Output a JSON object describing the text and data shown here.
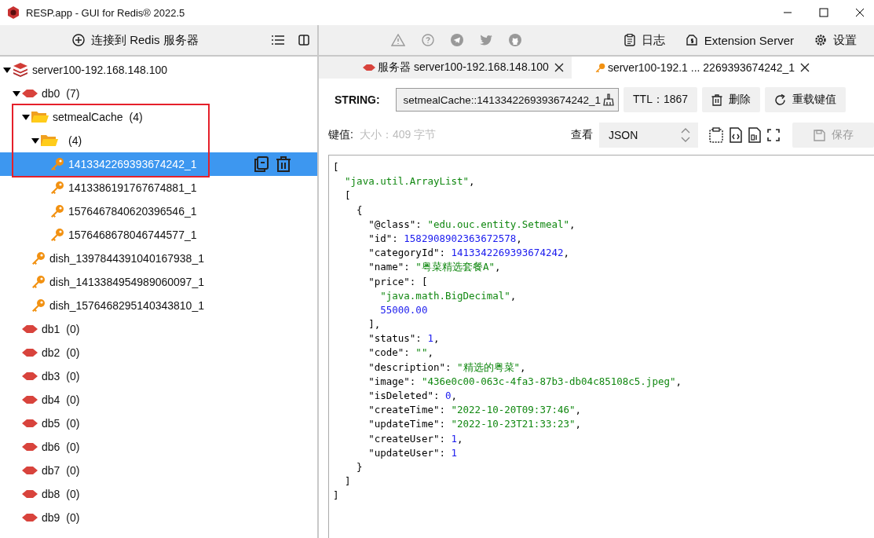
{
  "window": {
    "title": "RESP.app - GUI for Redis® 2022.5"
  },
  "sidebar": {
    "connect_button": "连接到 Redis 服务器",
    "tree": [
      {
        "kind": "server",
        "label": "server100-192.168.148.100",
        "expanded": true,
        "selected": false,
        "children": [
          {
            "kind": "db",
            "label": "db0",
            "count": "(7)",
            "expanded": true,
            "selected": false,
            "children": [
              {
                "kind": "folder",
                "label": "setmealCache",
                "count": "(4)",
                "expanded": true,
                "selected": false,
                "children": [
                  {
                    "kind": "folder",
                    "count": "(4)",
                    "expanded": true,
                    "selected": false,
                    "children": [
                      {
                        "kind": "key",
                        "label": "1413342269393674242_1",
                        "selected": true
                      },
                      {
                        "kind": "key",
                        "label": "1413386191767674881_1",
                        "selected": false
                      },
                      {
                        "kind": "key",
                        "label": "1576467840620396546_1",
                        "selected": false
                      },
                      {
                        "kind": "key",
                        "label": "1576468678046744577_1",
                        "selected": false
                      }
                    ]
                  }
                ]
              },
              {
                "kind": "key",
                "label": "dish_1397844391040167938_1",
                "selected": false
              },
              {
                "kind": "key",
                "label": "dish_1413384954989060097_1",
                "selected": false
              },
              {
                "kind": "key",
                "label": "dish_1576468295140343810_1",
                "selected": false
              }
            ]
          },
          {
            "kind": "db",
            "label": "db1",
            "count": "(0)",
            "selected": false
          },
          {
            "kind": "db",
            "label": "db2",
            "count": "(0)",
            "selected": false
          },
          {
            "kind": "db",
            "label": "db3",
            "count": "(0)",
            "selected": false
          },
          {
            "kind": "db",
            "label": "db4",
            "count": "(0)",
            "selected": false
          },
          {
            "kind": "db",
            "label": "db5",
            "count": "(0)",
            "selected": false
          },
          {
            "kind": "db",
            "label": "db6",
            "count": "(0)",
            "selected": false
          },
          {
            "kind": "db",
            "label": "db7",
            "count": "(0)",
            "selected": false
          },
          {
            "kind": "db",
            "label": "db8",
            "count": "(0)",
            "selected": false
          },
          {
            "kind": "db",
            "label": "db9",
            "count": "(0)",
            "selected": false
          }
        ]
      }
    ]
  },
  "toolbar": {
    "log_button": "日志",
    "extension_button": "Extension Server",
    "settings_button": "设置"
  },
  "tabs": [
    {
      "kind": "server",
      "label": "服务器 server100-192.168.148.100",
      "selected": false
    },
    {
      "kind": "key",
      "label": "server100-192.1 ... 2269393674242_1",
      "selected": true
    }
  ],
  "key_panel": {
    "type_label": "STRING:",
    "key_name": "setmealCache::1413342269393674242_1",
    "ttl": "TTL：1867",
    "delete_button": "删除",
    "reload_button": "重载键值",
    "value_label": "键值:",
    "size": "大小：409 字节",
    "view_label": "查看",
    "view_format": "JSON",
    "save_button": {
      "label": "保存",
      "disabled": true
    }
  },
  "editor": {
    "lines": [
      [
        {
          "kind": "plain",
          "text": "["
        }
      ],
      [
        {
          "kind": "string",
          "text": "  \"java.util.ArrayList\""
        },
        {
          "kind": "plain",
          "text": ","
        }
      ],
      [
        {
          "kind": "plain",
          "text": "  ["
        }
      ],
      [
        {
          "kind": "plain",
          "text": "    {"
        }
      ],
      [
        {
          "kind": "plain",
          "text": "      \"@class\": "
        },
        {
          "kind": "string",
          "text": "\"edu.ouc.entity.Setmeal\""
        },
        {
          "kind": "plain",
          "text": ","
        }
      ],
      [
        {
          "kind": "plain",
          "text": "      \"id\": "
        },
        {
          "kind": "number",
          "text": "1582908902363672578"
        },
        {
          "kind": "plain",
          "text": ","
        }
      ],
      [
        {
          "kind": "plain",
          "text": "      \"categoryId\": "
        },
        {
          "kind": "number",
          "text": "1413342269393674242"
        },
        {
          "kind": "plain",
          "text": ","
        }
      ],
      [
        {
          "kind": "plain",
          "text": "      \"name\": "
        },
        {
          "kind": "string",
          "text": "\"粤菜精选套餐A\""
        },
        {
          "kind": "plain",
          "text": ","
        }
      ],
      [
        {
          "kind": "plain",
          "text": "      \"price\": ["
        }
      ],
      [
        {
          "kind": "string",
          "text": "        \"java.math.BigDecimal\""
        },
        {
          "kind": "plain",
          "text": ","
        }
      ],
      [
        {
          "kind": "number",
          "text": "        55000.00"
        }
      ],
      [
        {
          "kind": "plain",
          "text": "      ],"
        }
      ],
      [
        {
          "kind": "plain",
          "text": "      \"status\": "
        },
        {
          "kind": "number",
          "text": "1"
        },
        {
          "kind": "plain",
          "text": ","
        }
      ],
      [
        {
          "kind": "plain",
          "text": "      \"code\": "
        },
        {
          "kind": "string",
          "text": "\"\""
        },
        {
          "kind": "plain",
          "text": ","
        }
      ],
      [
        {
          "kind": "plain",
          "text": "      \"description\": "
        },
        {
          "kind": "string",
          "text": "\"精选的粤菜\""
        },
        {
          "kind": "plain",
          "text": ","
        }
      ],
      [
        {
          "kind": "plain",
          "text": "      \"image\": "
        },
        {
          "kind": "string",
          "text": "\"436e0c00-063c-4fa3-87b3-db04c85108c5.jpeg\""
        },
        {
          "kind": "plain",
          "text": ","
        }
      ],
      [
        {
          "kind": "plain",
          "text": "      \"isDeleted\": "
        },
        {
          "kind": "number",
          "text": "0"
        },
        {
          "kind": "plain",
          "text": ","
        }
      ],
      [
        {
          "kind": "plain",
          "text": "      \"createTime\": "
        },
        {
          "kind": "string",
          "text": "\"2022-10-20T09:37:46\""
        },
        {
          "kind": "plain",
          "text": ","
        }
      ],
      [
        {
          "kind": "plain",
          "text": "      \"updateTime\": "
        },
        {
          "kind": "string",
          "text": "\"2022-10-23T21:33:23\""
        },
        {
          "kind": "plain",
          "text": ","
        }
      ],
      [
        {
          "kind": "plain",
          "text": "      \"createUser\": "
        },
        {
          "kind": "number",
          "text": "1"
        },
        {
          "kind": "plain",
          "text": ","
        }
      ],
      [
        {
          "kind": "plain",
          "text": "      \"updateUser\": "
        },
        {
          "kind": "number",
          "text": "1"
        }
      ],
      [
        {
          "kind": "plain",
          "text": "    }"
        }
      ],
      [
        {
          "kind": "plain",
          "text": "  ]"
        }
      ],
      [
        {
          "kind": "plain",
          "text": "]"
        }
      ]
    ]
  }
}
